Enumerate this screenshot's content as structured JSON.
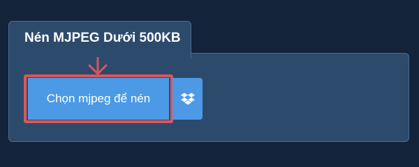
{
  "panel": {
    "title": "Nén MJPEG Dưới 500KB"
  },
  "actions": {
    "choose_label": "Chọn mjpeg để nén",
    "dropbox_icon": "dropbox-icon"
  },
  "colors": {
    "background": "#13233a",
    "panel": "#2c4a6c",
    "button": "#4c9ae6",
    "highlight": "#d9575c"
  }
}
